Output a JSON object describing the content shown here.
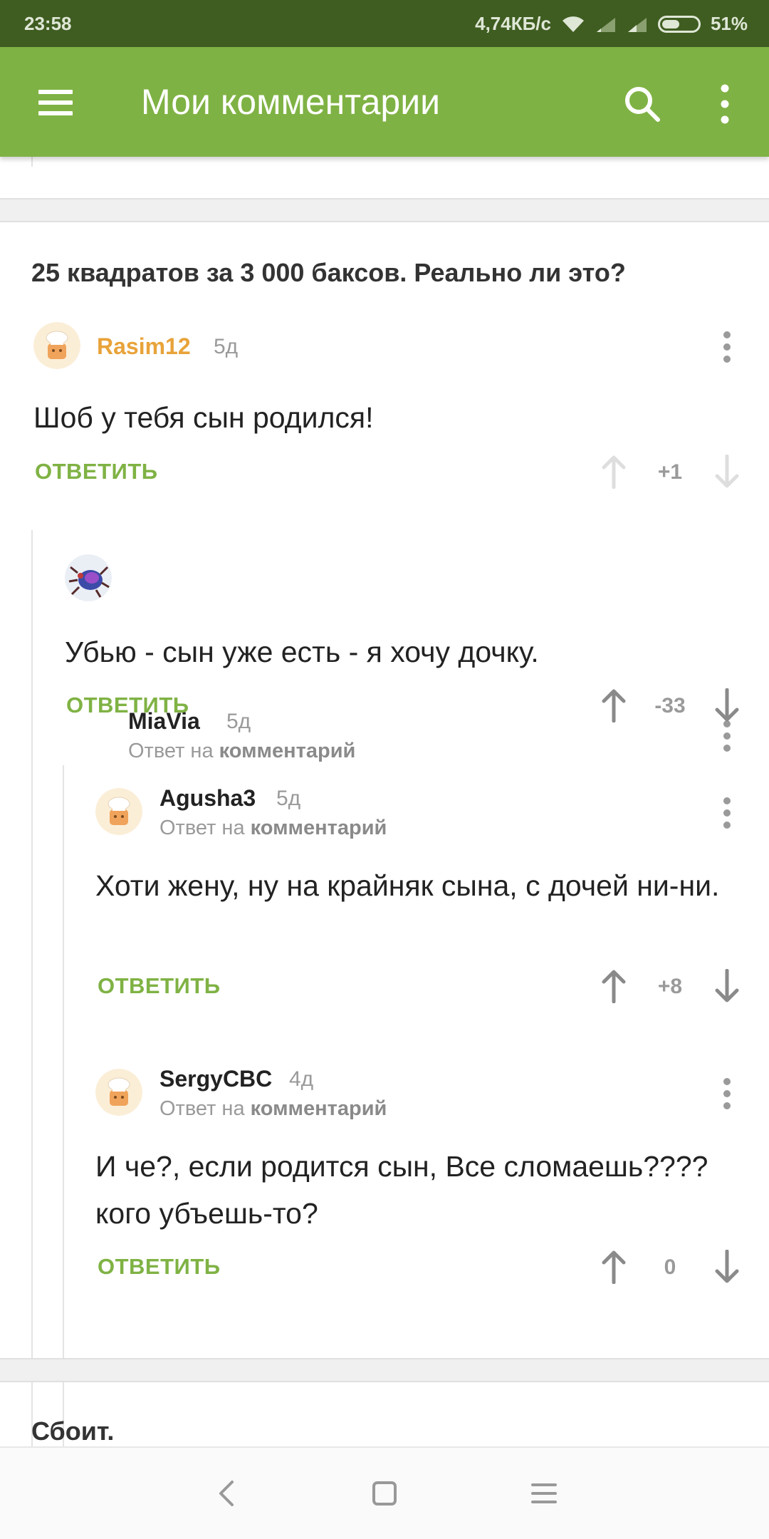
{
  "status_bar": {
    "time": "23:58",
    "speed": "4,74КБ/с",
    "battery_percent": "51%",
    "battery_level": 0.51
  },
  "toolbar": {
    "title": "Мои комментарии",
    "menu_icon": "hamburger-icon",
    "search_icon": "search-icon",
    "more_icon": "more-vert-icon",
    "color": "#7fb244"
  },
  "post": {
    "title": "25 квадратов за 3 000 баксов. Реально ли это?"
  },
  "comments": [
    {
      "author": "Rasim12",
      "author_color": "#e8a33a",
      "age": "5д",
      "text": "Шоб у тебя сын родился!",
      "reply_label": "ОТВЕТИТЬ",
      "score": "+1",
      "votes_disabled": true
    },
    {
      "author": "MiaVia",
      "age": "5д",
      "reply_prefix": "Ответ на",
      "reply_target": "комментарий",
      "text": "Убью - сын уже есть - я хочу дочку.",
      "reply_label": "ОТВЕТИТЬ",
      "score": "-33"
    },
    {
      "author": "Agusha3",
      "age": "5д",
      "reply_prefix": "Ответ на",
      "reply_target": "комментарий",
      "text": "Хоти жену, ну на крайняк сына, с дочей ни-ни.",
      "reply_label": "ОТВЕТИТЬ",
      "score": "+8"
    },
    {
      "author": "SergyCBC",
      "age": "4д",
      "reply_prefix": "Ответ на",
      "reply_target": "комментарий",
      "text": "И че?, если родится сын, Все сломаешь???? кого убъешь-то?",
      "reply_label": "ОТВЕТИТЬ",
      "score": "0"
    }
  ],
  "next_post": {
    "title": "Сбоит."
  },
  "nav_bar": {
    "back_icon": "back-icon",
    "home_icon": "home-icon",
    "recents_icon": "recents-icon"
  }
}
